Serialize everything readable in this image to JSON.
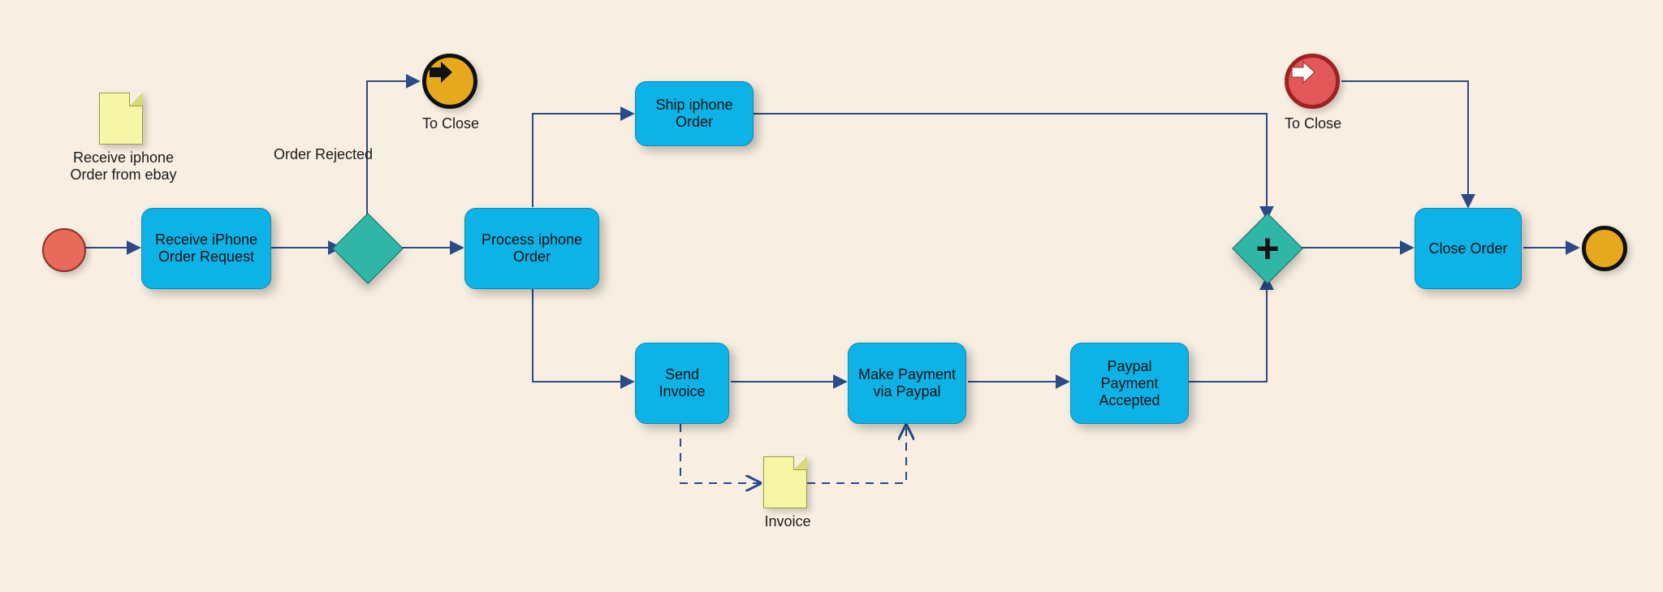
{
  "nodes": {
    "receive_order": {
      "label": "Receive iPhone Order Request"
    },
    "process_order": {
      "label": "Process iphone Order"
    },
    "ship_order": {
      "label": "Ship iphone Order"
    },
    "send_invoice": {
      "label": "Send Invoice"
    },
    "make_payment": {
      "label": "Make Payment via Paypal"
    },
    "payment_accepted": {
      "label": "Paypal Payment Accepted"
    },
    "close_order": {
      "label": "Close Order"
    }
  },
  "labels": {
    "order_rejected": "Order Rejected",
    "to_close_1": "To Close",
    "to_close_2": "To Close",
    "doc_receive": "Receive iphone Order from ebay",
    "doc_invoice": "Invoice"
  },
  "chart_data": {
    "type": "bpmn-flow",
    "events": [
      {
        "id": "start",
        "type": "start"
      },
      {
        "id": "link_throw_toclose",
        "type": "link-throw",
        "label": "To Close"
      },
      {
        "id": "link_catch_toclose",
        "type": "link-catch",
        "label": "To Close"
      },
      {
        "id": "end",
        "type": "end"
      }
    ],
    "gateways": [
      {
        "id": "gw_decision",
        "type": "exclusive"
      },
      {
        "id": "gw_parallel_join",
        "type": "parallel"
      }
    ],
    "tasks": [
      "receive_order",
      "process_order",
      "ship_order",
      "send_invoice",
      "make_payment",
      "payment_accepted",
      "close_order"
    ],
    "data_objects": [
      {
        "id": "doc_receive",
        "label": "Receive iphone Order from ebay"
      },
      {
        "id": "doc_invoice",
        "label": "Invoice"
      }
    ],
    "sequence_flows": [
      [
        "start",
        "receive_order"
      ],
      [
        "receive_order",
        "gw_decision"
      ],
      [
        "gw_decision",
        "link_throw_toclose",
        "Order Rejected"
      ],
      [
        "gw_decision",
        "process_order"
      ],
      [
        "process_order",
        "ship_order"
      ],
      [
        "process_order",
        "send_invoice"
      ],
      [
        "ship_order",
        "gw_parallel_join"
      ],
      [
        "send_invoice",
        "make_payment"
      ],
      [
        "make_payment",
        "payment_accepted"
      ],
      [
        "payment_accepted",
        "gw_parallel_join"
      ],
      [
        "gw_parallel_join",
        "close_order"
      ],
      [
        "link_catch_toclose",
        "close_order"
      ],
      [
        "close_order",
        "end"
      ]
    ],
    "associations": [
      [
        "send_invoice",
        "doc_invoice"
      ],
      [
        "doc_invoice",
        "make_payment"
      ]
    ]
  }
}
